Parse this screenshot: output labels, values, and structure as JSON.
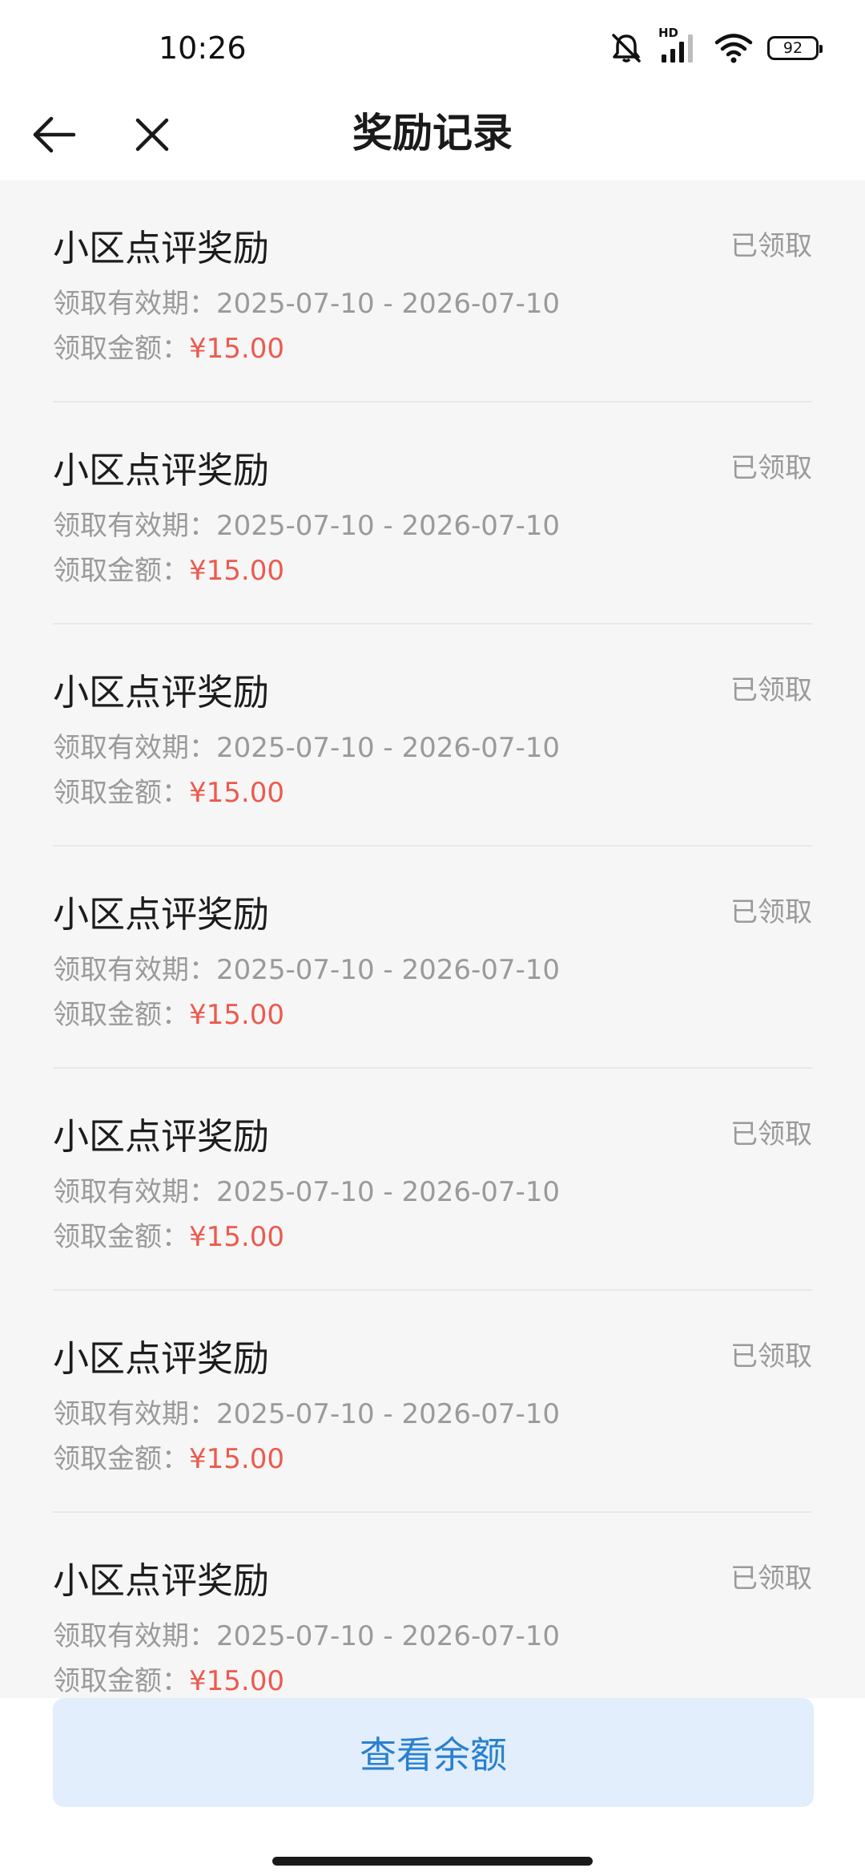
{
  "status_bar": {
    "time": "10:26",
    "network_label": "HD",
    "battery": "92"
  },
  "header": {
    "title": "奖励记录"
  },
  "records": [
    {
      "title": "小区点评奖励",
      "status": "已领取",
      "validity_label": "领取有效期：",
      "validity": "2025-07-10 - 2026-07-10",
      "amount_label": "领取金额：",
      "amount": "¥15.00"
    },
    {
      "title": "小区点评奖励",
      "status": "已领取",
      "validity_label": "领取有效期：",
      "validity": "2025-07-10 - 2026-07-10",
      "amount_label": "领取金额：",
      "amount": "¥15.00"
    },
    {
      "title": "小区点评奖励",
      "status": "已领取",
      "validity_label": "领取有效期：",
      "validity": "2025-07-10 - 2026-07-10",
      "amount_label": "领取金额：",
      "amount": "¥15.00"
    },
    {
      "title": "小区点评奖励",
      "status": "已领取",
      "validity_label": "领取有效期：",
      "validity": "2025-07-10 - 2026-07-10",
      "amount_label": "领取金额：",
      "amount": "¥15.00"
    },
    {
      "title": "小区点评奖励",
      "status": "已领取",
      "validity_label": "领取有效期：",
      "validity": "2025-07-10 - 2026-07-10",
      "amount_label": "领取金额：",
      "amount": "¥15.00"
    },
    {
      "title": "小区点评奖励",
      "status": "已领取",
      "validity_label": "领取有效期：",
      "validity": "2025-07-10 - 2026-07-10",
      "amount_label": "领取金额：",
      "amount": "¥15.00"
    },
    {
      "title": "小区点评奖励",
      "status": "已领取",
      "validity_label": "领取有效期：",
      "validity": "2025-07-10 - 2026-07-10",
      "amount_label": "领取金额：",
      "amount": "¥15.00"
    }
  ],
  "footer": {
    "button_label": "查看余额"
  },
  "icons": {
    "back": "arrow-left-icon",
    "close": "close-icon",
    "mute": "bell-off-icon",
    "signal": "signal-icon",
    "wifi": "wifi-icon",
    "battery": "battery-icon"
  },
  "colors": {
    "amount": "#ec5a4e",
    "button_text": "#2980cf",
    "button_bg": "#e2eefb",
    "muted_text": "#9a9a9a",
    "page_bg": "#f6f6f6"
  }
}
